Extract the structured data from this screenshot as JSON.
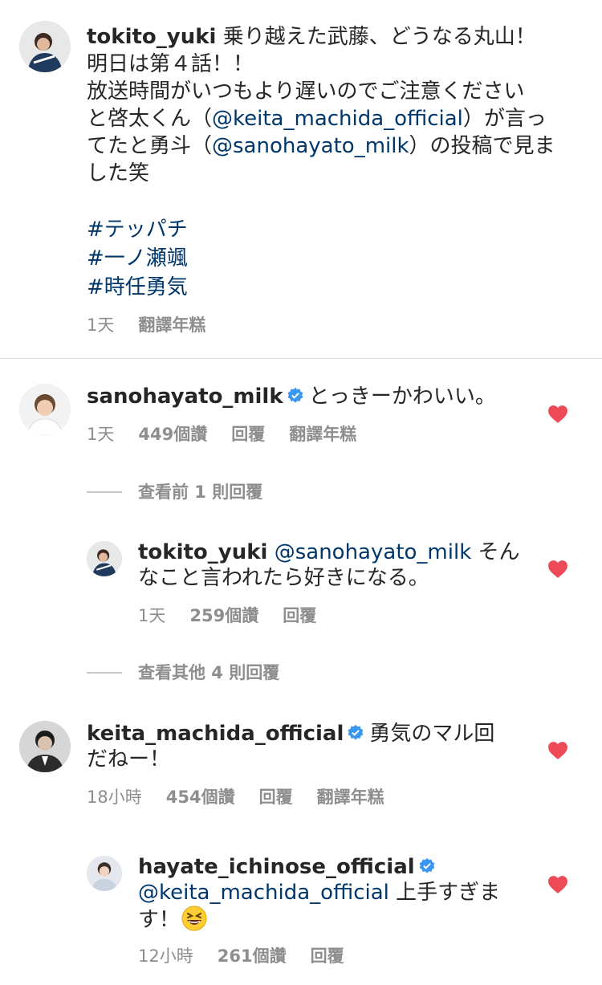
{
  "caption": {
    "username": "tokito_yuki",
    "line1_rest": " 乗り越えた武藤、どうなる丸山！",
    "line2": "明日は第４話！！",
    "line3": "放送時間がいつもより遅いのでご注意ください",
    "line4_a": "と啓太くん（",
    "line4_mention": "@keita_machida_official",
    "line4_b": "）が言っ",
    "line5_a": "てたと勇斗（",
    "line5_mention": "@sanohayato_milk",
    "line5_b": "）の投稿で見ま",
    "line6": "した笑",
    "hashtags": [
      "#テッパチ",
      "#一ノ瀬颯",
      "#時任勇気"
    ],
    "time": "1天",
    "translate": "翻譯年糕"
  },
  "comment1": {
    "username": "sanohayato_milk",
    "text": "とっきーかわいい。",
    "time": "1天",
    "likes": "449個讚",
    "reply": "回覆",
    "translate": "翻譯年糕"
  },
  "view_prev_replies": "查看前 1 則回覆",
  "reply1": {
    "username": "tokito_yuki",
    "mention": "@sanohayato_milk",
    "text_a": " そん",
    "text_b": "なこと言われたら好きになる。",
    "time": "1天",
    "likes": "259個讚",
    "reply": "回覆"
  },
  "view_other_replies": "查看其他 4 則回覆",
  "comment2": {
    "username": "keita_machida_official",
    "text_a": "勇気のマル回",
    "text_b": "だねー！",
    "time": "18小時",
    "likes": "454個讚",
    "reply": "回覆",
    "translate": "翻譯年糕"
  },
  "reply2": {
    "username": "hayate_ichinose_official",
    "mention": "@keita_machida_official",
    "text_a": " 上手すぎま",
    "text_b": "す！",
    "emoji": "grinning-squinting-face",
    "time": "12小時",
    "likes": "261個讚",
    "reply": "回覆"
  },
  "colors": {
    "link": "#00376b",
    "meta": "#8e8e8e",
    "heart": "#ed4956",
    "verified": "#3897f0"
  }
}
